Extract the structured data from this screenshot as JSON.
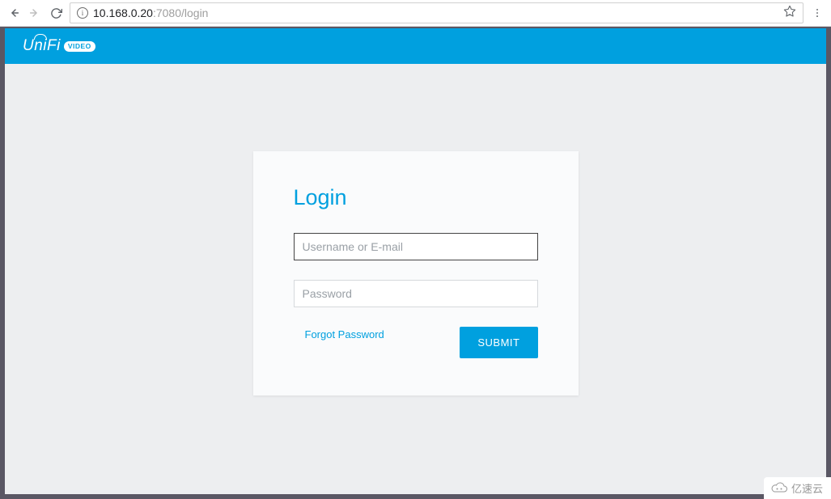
{
  "browser": {
    "url_host": "10.168.0.20",
    "url_path": ":7080/login"
  },
  "header": {
    "logo_word": "UniFi",
    "logo_badge": "VIDEO"
  },
  "login": {
    "title": "Login",
    "username_placeholder": "Username or E-mail",
    "password_placeholder": "Password",
    "forgot_label": "Forgot Password",
    "submit_label": "SUBMIT"
  },
  "watermark": {
    "text": "亿速云"
  },
  "colors": {
    "accent": "#00a0df",
    "page_bg": "#edeef0"
  }
}
